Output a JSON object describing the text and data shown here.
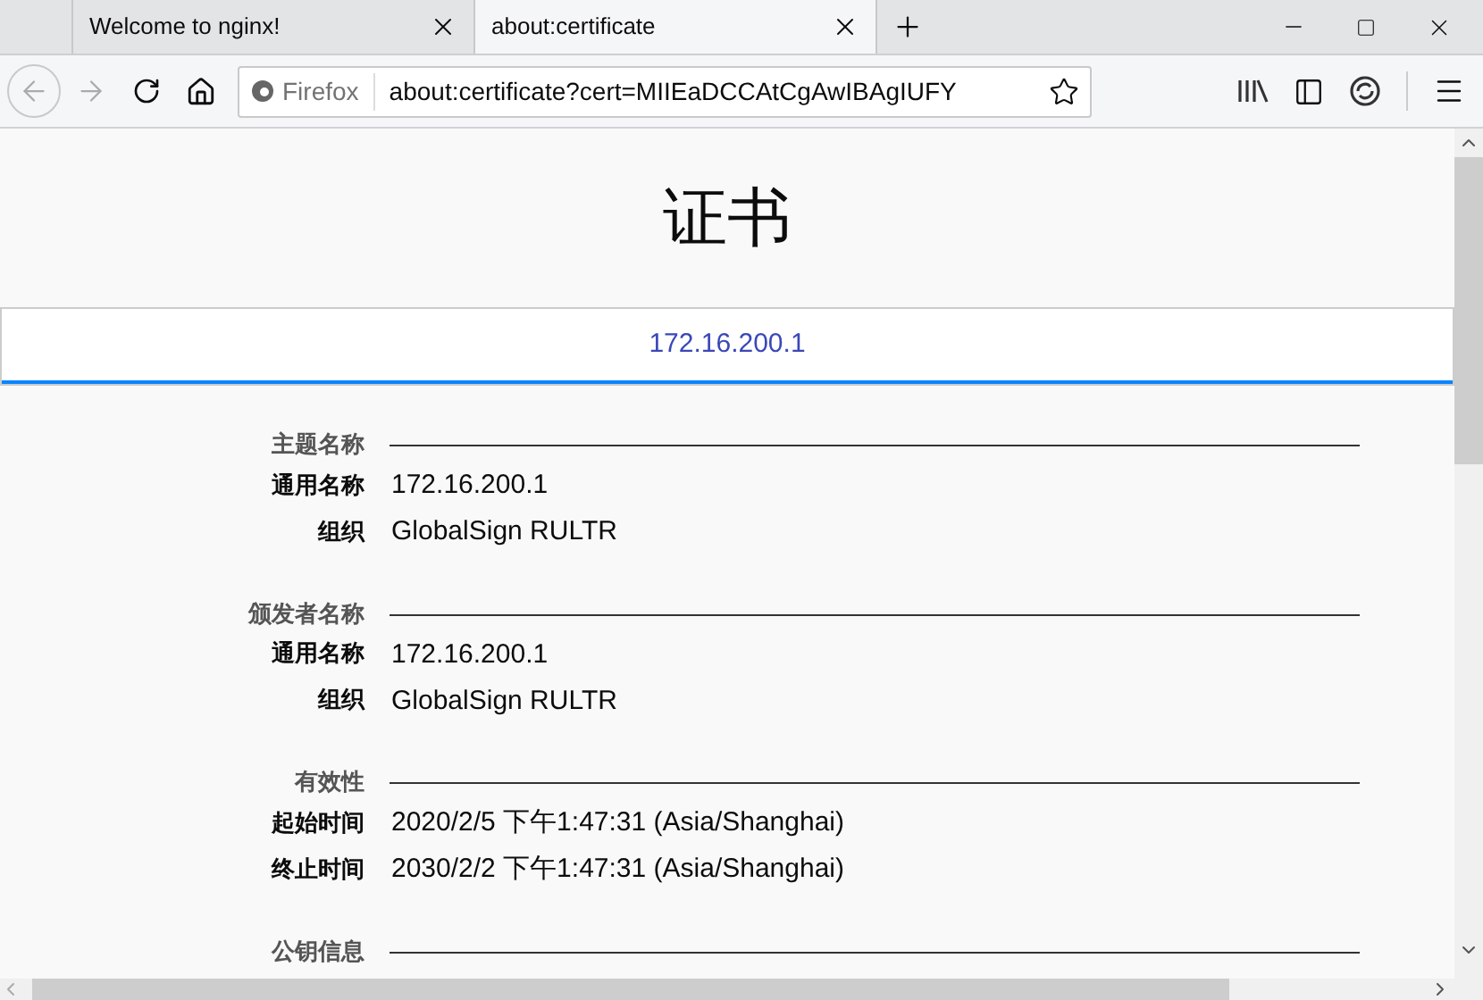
{
  "browser_tabs": [
    {
      "title": "Welcome to nginx!",
      "selected": false
    },
    {
      "title": "about:certificate",
      "selected": true
    }
  ],
  "toolbar": {
    "identity_label": "Firefox",
    "url": "about:certificate?cert=MIIEaDCCAtCgAwIBAgIUFY"
  },
  "page": {
    "title": "证书",
    "cert_tabs": [
      {
        "label": "172.16.200.1",
        "selected": true
      }
    ],
    "sections": [
      {
        "heading": "主题名称",
        "rows": [
          {
            "label": "通用名称",
            "value": "172.16.200.1"
          },
          {
            "label": "组织",
            "value": "GlobalSign RULTR"
          }
        ]
      },
      {
        "heading": "颁发者名称",
        "rows": [
          {
            "label": "通用名称",
            "value": "172.16.200.1"
          },
          {
            "label": "组织",
            "value": "GlobalSign RULTR"
          }
        ]
      },
      {
        "heading": "有效性",
        "rows": [
          {
            "label": "起始时间",
            "value": "2020/2/5 下午1:47:31 (Asia/Shanghai)"
          },
          {
            "label": "终止时间",
            "value": "2030/2/2 下午1:47:31 (Asia/Shanghai)"
          }
        ]
      },
      {
        "heading": "公钥信息"
      }
    ]
  }
}
